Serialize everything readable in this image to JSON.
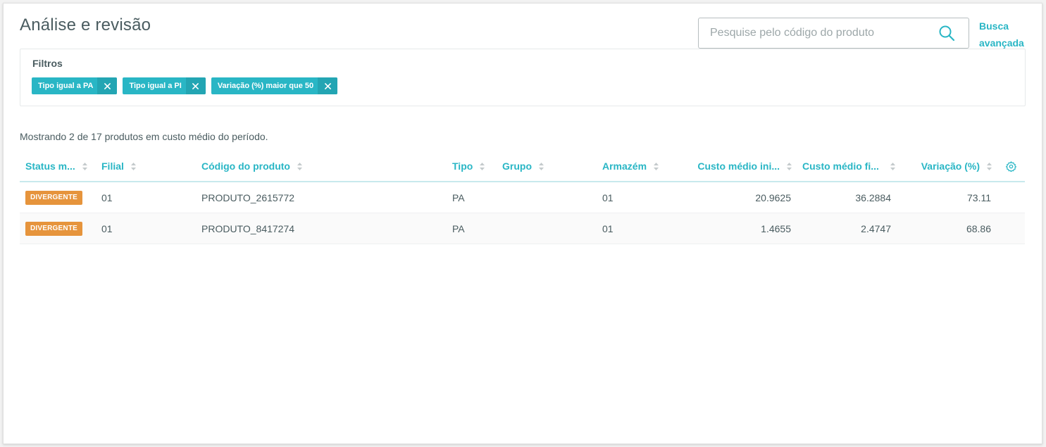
{
  "header": {
    "title": "Análise e revisão",
    "search_placeholder": "Pesquise pelo código do produto",
    "search_value": "",
    "advanced_search_line1": "Busca",
    "advanced_search_line2": "avançada"
  },
  "filters": {
    "title": "Filtros",
    "chips": [
      {
        "label": "Tipo igual a PA"
      },
      {
        "label": "Tipo igual a PI"
      },
      {
        "label": "Variação (%) maior que 50"
      }
    ],
    "chip_color": "#29b6c5"
  },
  "summary": "Mostrando 2 de 17 produtos em custo médio do período.",
  "table": {
    "columns": [
      {
        "label": "Status m..."
      },
      {
        "label": "Filial"
      },
      {
        "label": "Código do produto"
      },
      {
        "label": "Tipo"
      },
      {
        "label": "Grupo"
      },
      {
        "label": "Armazém"
      },
      {
        "label": "Custo médio ini..."
      },
      {
        "label": "Custo médio fi..."
      },
      {
        "label": "Variação (%)"
      }
    ],
    "rows": [
      {
        "status": "DIVERGENTE",
        "filial": "01",
        "codigo": "PRODUTO_2615772",
        "tipo": "PA",
        "grupo": "",
        "armazem": "01",
        "custo_inicial": "20.9625",
        "custo_final": "36.2884",
        "variacao": "73.11"
      },
      {
        "status": "DIVERGENTE",
        "filial": "01",
        "codigo": "PRODUTO_8417274",
        "tipo": "PA",
        "grupo": "",
        "armazem": "01",
        "custo_inicial": "1.4655",
        "custo_final": "2.4747",
        "variacao": "68.86"
      }
    ],
    "status_color": "#e6943c",
    "accent_color": "#29b6c5"
  },
  "icons": {
    "search": "search-icon",
    "chip_close": "close-icon",
    "sort": "sort-icon",
    "settings": "gear-icon"
  }
}
